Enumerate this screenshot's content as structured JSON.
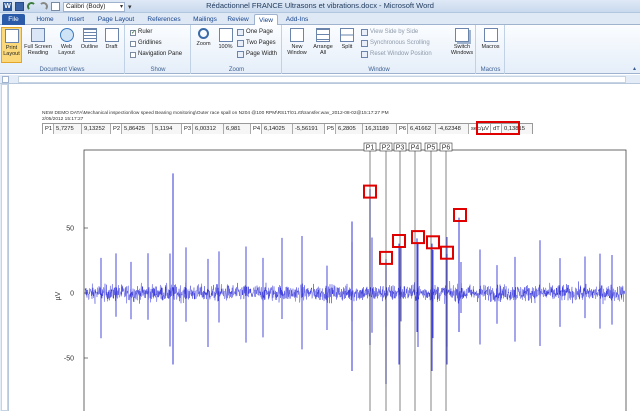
{
  "window": {
    "title": "Rédactionnel FRANCE  Ultrasons et vibrations.docx  -  Microsoft Word",
    "font_name": "Calibri (Body)"
  },
  "tabs": [
    "File",
    "Home",
    "Insert",
    "Page Layout",
    "References",
    "Mailings",
    "Review",
    "View",
    "Add-Ins"
  ],
  "active_tab": "View",
  "ribbon": {
    "document_views": {
      "label": "Document Views",
      "print_layout": "Print Layout",
      "full_screen": "Full Screen Reading",
      "web_layout": "Web Layout",
      "outline": "Outline",
      "draft": "Draft"
    },
    "show": {
      "label": "Show",
      "ruler": "Ruler",
      "ruler_checked": true,
      "gridlines": "Gridlines",
      "gridlines_checked": false,
      "navigation_pane": "Navigation Pane",
      "navigation_checked": false
    },
    "zoom": {
      "label": "Zoom",
      "zoom": "Zoom",
      "hundred": "100%",
      "one_page": "One Page",
      "two_pages": "Two Pages",
      "page_width": "Page Width"
    },
    "window": {
      "label": "Window",
      "new_window": "New Window",
      "arrange_all": "Arrange All",
      "split": "Split",
      "side_by_side": "View Side by Side",
      "sync_scrolling": "Synchronous Scrolling",
      "reset_position": "Reset Window Position",
      "switch_windows": "Switch Windows"
    },
    "macros": {
      "label": "Macros",
      "macros": "Macros"
    }
  },
  "document": {
    "header_line1": "NEW DEMO DATA\\Mechanical inspection\\low  speed Bearing monitoring\\Outer race spall on N204 @100 RPM\\RS1T\\01.rtt\\transfer.wav_2012-08-02@15:17:27 PM",
    "header_line2": "2/05/2012 15:17:27",
    "params": [
      {
        "label": "P1",
        "a": "5,7275",
        "b": "9,13252"
      },
      {
        "label": "P2",
        "a": "5,86425",
        "b": "5,1194"
      },
      {
        "label": "P3",
        "a": "6,00312",
        "b": "6,981"
      },
      {
        "label": "P4",
        "a": "6,14025",
        "b": "-5,56191"
      },
      {
        "label": "P5",
        "a": "6,2805",
        "b": "16,31189"
      },
      {
        "label": "P6",
        "a": "6,41662",
        "b": "-4,62348"
      }
    ],
    "unit_label": "sec/µV",
    "dt_label": "dT",
    "dt_value": "0,13815"
  },
  "chart_data": {
    "type": "line",
    "ylabel": "µV",
    "yticks": [
      50,
      0,
      -50
    ],
    "ylim": [
      -85,
      95
    ],
    "markers": [
      "P1",
      "P2",
      "P3",
      "P4",
      "P5",
      "P6"
    ],
    "highlight_color": "#e00000",
    "series_color": "#1f1fd6",
    "peaks_marked": [
      {
        "marker": "P1",
        "y": 78
      },
      {
        "marker": "P2",
        "y": 27
      },
      {
        "marker": "P3",
        "y": 40
      },
      {
        "marker": "P4",
        "y": 43
      },
      {
        "marker": "P5",
        "y": 39
      },
      {
        "marker": "P6",
        "y": 31
      },
      {
        "marker": "",
        "y": 60
      }
    ]
  }
}
